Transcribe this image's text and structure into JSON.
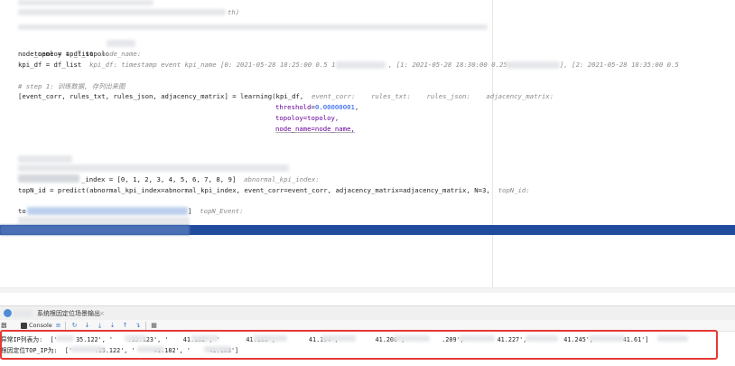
{
  "code": {
    "line_top_fragment": "th)",
    "line1": "topoloy = df_topolo",
    "line2_code": "node_name = ip_list",
    "line2_hint": "node_name:",
    "line3_code": "kpi_df = df_list",
    "line3_hint": "kpi_df: timestamp event kpi_name [0: 2021-05-28 18:25:00 0.5 1",
    "line3_hint2": ", [1: 2021-05-28 18:30:00 0.25",
    "line3_hint3": "], [2: 2021-05-28 18:35:00 0.5",
    "comment_step1": "# step 1: 训练数据, 存列出来图",
    "line4_code": "[event_corr, rules_txt, rules_json, adjacency_matrix] = learning(kpi_df,",
    "line4_hint": "event_corr:    rules_txt:    rules_json:    adjacency_matrix:",
    "arg_threshold_name": "threshold",
    "arg_threshold_value": "0.00000001",
    "arg_topoloy": "topoloy=topoloy,",
    "arg_node_name": "node_name=node_name,",
    "line_index_code": "_index = [0, 1, 2, 3, 4, 5, 6, 7, 8, 9]",
    "line_index_hint": "abnormal_kpi_index:",
    "line_predict": "topN_id = predict(abnormal_kpi_index=abnormal_kpi_index, event_corr=event_corr, adjacency_matrix=adjacency_matrix, N=3,",
    "line_predict_hint": "topN_id:",
    "line_event_prefix": "to",
    "line_event_bracket": "]",
    "line_event_hint": "topN_Event:"
  },
  "panel": {
    "run_tab_label": "系统根因定位场景输出",
    "run_tab_close": "×",
    "toolbar_left_label": "器",
    "console_label": "Console"
  },
  "console": {
    "line1": "异常IP列表为:  ['     35.122', '    .35.123', '    41.182', '       41.183', '       41.194', '        41.208', '        .209', '       41.227', '        41.245', '      41.61']",
    "line2": "根因定位TOP_IP为:  ['      .35.122', '     41.182', '     41.183']"
  },
  "colors": {
    "highlight": "#214b9c",
    "alert_border": "#e53935",
    "number": "#1750eb",
    "keyword_arg": "#660099",
    "comment": "#8c8c8c"
  }
}
